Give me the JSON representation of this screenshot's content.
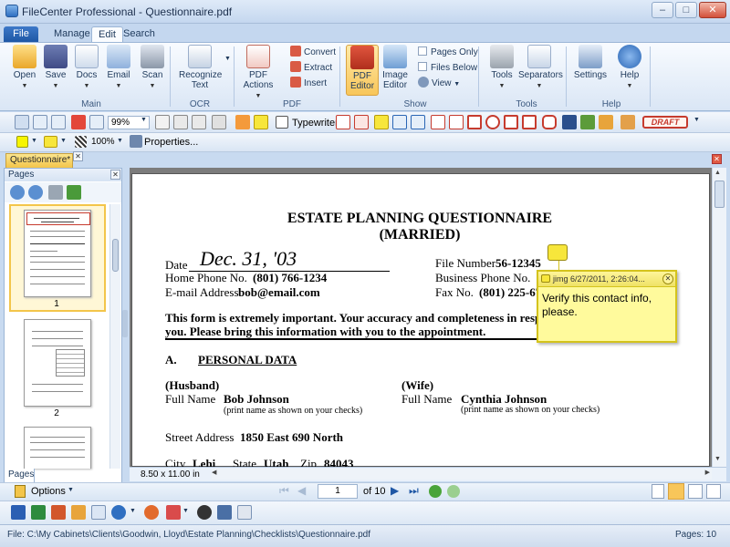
{
  "window": {
    "title": "FileCenter Professional - Questionnaire.pdf"
  },
  "tabs": [
    {
      "label": "File"
    },
    {
      "label": "Manage"
    },
    {
      "label": "Edit"
    },
    {
      "label": "Search"
    }
  ],
  "ribbon": {
    "main": {
      "label": "Main",
      "buttons": [
        "Open",
        "Save",
        "Docs",
        "Email",
        "Scan"
      ]
    },
    "ocr": {
      "label": "OCR",
      "button": "Recognize\nText"
    },
    "pdf": {
      "label": "PDF",
      "button": "PDF\nActions",
      "small": [
        "Convert",
        "Extract",
        "Insert"
      ]
    },
    "show": {
      "label": "Show",
      "buttons": [
        "PDF\nEditor",
        "Image\nEditor"
      ],
      "checks": [
        "Pages Only",
        "Files Below"
      ],
      "view": "View"
    },
    "tools": {
      "label": "Tools",
      "buttons": [
        "Tools",
        "Separators"
      ]
    },
    "help": {
      "label": "Help",
      "buttons": [
        "Settings",
        "Help"
      ]
    }
  },
  "toolbar": {
    "zoom": "99%",
    "typewriter": "Typewriter",
    "stamp": "DRAFT",
    "zoom2": "100%",
    "properties": "Properties..."
  },
  "document_tab": "Questionnaire*",
  "pages_panel": {
    "header": "Pages",
    "thumbnails": [
      "1",
      "2"
    ],
    "tab_label": "Pages"
  },
  "page_size": "8.50 x 11.00 in",
  "navigation": {
    "options": "Options",
    "current_page": "1",
    "of_pages": "of 10"
  },
  "status": {
    "file": "File: C:\\My Cabinets\\Clients\\Goodwin, Lloyd\\Estate Planning\\Checklists\\Questionnaire.pdf",
    "pages": "Pages: 10"
  },
  "document": {
    "title1": "ESTATE PLANNING QUESTIONNAIRE",
    "title2": "(MARRIED)",
    "date_label": "Date",
    "date_value": "Dec. 31, '03",
    "file_number_label": "File Number",
    "file_number": "56-12345",
    "home_phone_label": "Home Phone No.",
    "home_phone": "(801) 766-1234",
    "business_phone_label": "Business Phone No.",
    "email_label": "E-mail Address",
    "email": "bob@email.com",
    "fax_label": "Fax No.",
    "fax": "(801) 225-675",
    "notice_line1": "This form is extremely important.  Your accuracy and completeness in respondi",
    "notice_line2": "you.  Please bring this information with you to the appointment.",
    "section_num": "A.",
    "section_title": "PERSONAL DATA",
    "husband_label": "(Husband)",
    "wife_label": "(Wife)",
    "fullname_label": "Full Name",
    "husband_name": "Bob Johnson",
    "wife_name": "Cynthia Johnson",
    "print_hint": "(print name as shown on your checks)",
    "street_label": "Street Address",
    "street": "1850 East 690 North",
    "city_label": "City",
    "city": "Lehi",
    "state_label": "State",
    "state": "Utah",
    "zip_label": "Zip",
    "zip": "84043"
  },
  "note": {
    "header": "jimg 6/27/2011, 2:26:04...",
    "body": "Verify this contact info, please."
  }
}
